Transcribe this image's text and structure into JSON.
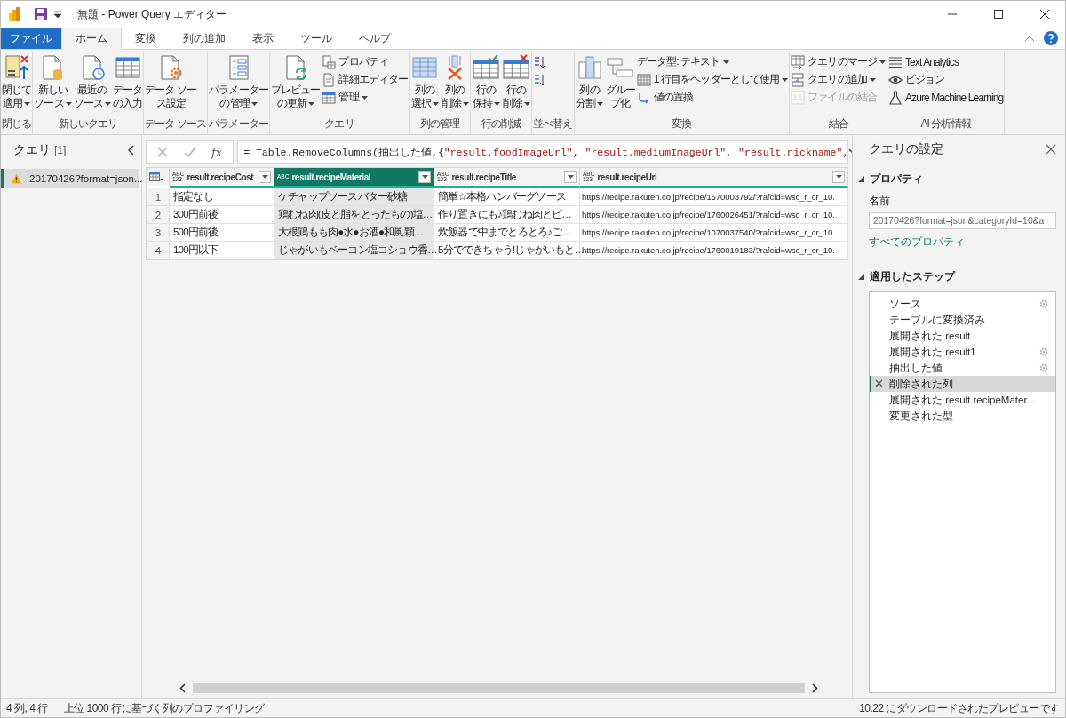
{
  "window": {
    "title": "無題 - Power Query エディター"
  },
  "ribbon_tabs": [
    {
      "label": "ファイル",
      "kind": "file",
      "selected": false
    },
    {
      "label": "ホーム",
      "kind": "tab",
      "selected": true
    },
    {
      "label": "変換",
      "kind": "tab",
      "selected": false
    },
    {
      "label": "列の追加",
      "kind": "tab",
      "selected": false
    },
    {
      "label": "表示",
      "kind": "tab",
      "selected": false
    },
    {
      "label": "ツール",
      "kind": "tab",
      "selected": false
    },
    {
      "label": "ヘルプ",
      "kind": "tab",
      "selected": false
    }
  ],
  "ribbon_groups": [
    {
      "label": "閉じる",
      "items": [
        {
          "kind": "large",
          "label": [
            "閉じて",
            "適用"
          ],
          "dropdown": true,
          "disabled": false
        }
      ]
    },
    {
      "label": "新しいクエリ",
      "items": [
        {
          "kind": "large",
          "label": [
            "新しい",
            "ソース"
          ],
          "dropdown": true,
          "disabled": false
        },
        {
          "kind": "large",
          "label": [
            "最近の",
            "ソース"
          ],
          "dropdown": true,
          "disabled": false
        },
        {
          "kind": "large",
          "label": [
            "データ",
            "の入力"
          ],
          "dropdown": false,
          "disabled": false
        }
      ]
    },
    {
      "label": "データ ソース",
      "items": [
        {
          "kind": "large",
          "label": [
            "データ ソー",
            "ス設定"
          ],
          "dropdown": false,
          "disabled": false
        }
      ]
    },
    {
      "label": "パラメーター",
      "items": [
        {
          "kind": "large",
          "label": [
            "パラメーター",
            "の管理"
          ],
          "dropdown": true,
          "disabled": false
        }
      ]
    },
    {
      "label": "クエリ",
      "items": [
        {
          "kind": "large",
          "label": [
            "プレビュー",
            "の更新"
          ],
          "dropdown": true,
          "disabled": false
        },
        {
          "kind": "small",
          "label": "プロパティ",
          "dropdown": false,
          "disabled": false
        },
        {
          "kind": "small",
          "label": "詳細エディター",
          "dropdown": false,
          "disabled": false
        },
        {
          "kind": "small",
          "label": "管理",
          "dropdown": true,
          "disabled": false
        }
      ]
    },
    {
      "label": "列の管理",
      "items": [
        {
          "kind": "large",
          "label": [
            "列の",
            "選択"
          ],
          "dropdown": true,
          "disabled": false
        },
        {
          "kind": "large",
          "label": [
            "列の",
            "削除"
          ],
          "dropdown": true,
          "disabled": false
        }
      ]
    },
    {
      "label": "行の削減",
      "items": [
        {
          "kind": "large",
          "label": [
            "行の",
            "保持"
          ],
          "dropdown": true,
          "disabled": false
        },
        {
          "kind": "large",
          "label": [
            "行の",
            "削除"
          ],
          "dropdown": true,
          "disabled": false
        }
      ]
    },
    {
      "label": "並べ替え",
      "items": [
        {
          "kind": "icon",
          "dropdown": false,
          "disabled": false
        },
        {
          "kind": "icon",
          "dropdown": false,
          "disabled": false
        }
      ]
    },
    {
      "label": "変換",
      "items": [
        {
          "kind": "large",
          "label": [
            "列の",
            "分割"
          ],
          "dropdown": true,
          "disabled": false
        },
        {
          "kind": "large",
          "label": [
            "グルー",
            "プ化"
          ],
          "dropdown": false,
          "disabled": false
        },
        {
          "kind": "small",
          "label": "データ型: テキスト",
          "dropdown": true,
          "disabled": false
        },
        {
          "kind": "small",
          "label": "1 行目をヘッダーとして使用",
          "dropdown": true,
          "disabled": false
        },
        {
          "kind": "small",
          "label": "値の置換",
          "dropdown": false,
          "disabled": false
        }
      ]
    },
    {
      "label": "結合",
      "items": [
        {
          "kind": "small",
          "label": "クエリのマージ",
          "dropdown": true,
          "disabled": false
        },
        {
          "kind": "small",
          "label": "クエリの追加",
          "dropdown": true,
          "disabled": false
        },
        {
          "kind": "small",
          "label": "ファイルの結合",
          "dropdown": false,
          "disabled": true
        }
      ]
    },
    {
      "label": "AI 分析情報",
      "items": [
        {
          "kind": "small",
          "label": "Text Analytics",
          "dropdown": false,
          "disabled": false
        },
        {
          "kind": "small",
          "label": "ビジョン",
          "dropdown": false,
          "disabled": false
        },
        {
          "kind": "small",
          "label": "Azure Machine Learning",
          "dropdown": false,
          "disabled": false
        }
      ]
    }
  ],
  "queries": {
    "title": "クエリ",
    "count": "[1]",
    "items": [
      {
        "label": "20170426?format=json...",
        "selected": true
      }
    ]
  },
  "formula": {
    "label": "fx",
    "segments": [
      {
        "kind": "code",
        "text": "= Table.RemoveColumns(抽出した値,{"
      },
      {
        "kind": "string",
        "text": "\"result.foodImageUrl\""
      },
      {
        "kind": "code",
        "text": ", "
      },
      {
        "kind": "string",
        "text": "\"result.mediumImageUrl\""
      },
      {
        "kind": "code",
        "text": ", "
      },
      {
        "kind": "string",
        "text": "\"result.nickname\""
      },
      {
        "kind": "code",
        "text": ","
      }
    ]
  },
  "table": {
    "columns": [
      {
        "name": "result.recipeCost",
        "type_label": [
          "ABC",
          "123"
        ],
        "selected": false
      },
      {
        "name": "result.recipeMaterial",
        "type_label": [
          "ABC"
        ],
        "selected": true
      },
      {
        "name": "result.recipeTitle",
        "type_label": [
          "ABC",
          "123"
        ],
        "selected": false
      },
      {
        "name": "result.recipeUrl",
        "type_label": [
          "ABC",
          "123"
        ],
        "selected": false
      }
    ],
    "rows": [
      {
        "number": "1",
        "cells": [
          "指定なし",
          "ケチャップソースバター砂糖",
          "簡単☆本格ハンバーグソース",
          "https://recipe.rakuten.co.jp/recipe/1570003792/?rafcid=wsc_r_cr_10."
        ]
      },
      {
        "number": "2",
        "cells": [
          "300円前後",
          "鶏むね肉(皮と脂をとったもの)塩…",
          "作り置きにも♪鶏むね肉とピ…",
          "https://recipe.rakuten.co.jp/recipe/1760026451/?rafcid=wsc_r_cr_10."
        ]
      },
      {
        "number": "3",
        "cells": [
          "500円前後",
          "大根鶏もも肉●水●お酒●和風顆…",
          "炊飯器で中までとろとろ♪ご…",
          "https://recipe.rakuten.co.jp/recipe/1070037540/?rafcid=wsc_r_cr_10."
        ]
      },
      {
        "number": "4",
        "cells": [
          "100円以下",
          "じゃがいもベーコン塩コショウ香…",
          "5分でできちゃう!じゃがいもと…",
          "https://recipe.rakuten.co.jp/recipe/1760019183/?rafcid=wsc_r_cr_10."
        ]
      }
    ]
  },
  "settings": {
    "title": "クエリの設定",
    "properties": {
      "heading": "プロパティ",
      "expanded": true,
      "name_label": "名前",
      "name_value": "20170426?format=json&categoryId=10&a",
      "link": "すべてのプロパティ"
    },
    "steps": {
      "heading": "適用したステップ",
      "expanded": true,
      "items": [
        {
          "label": "ソース",
          "settings": true,
          "selected": false
        },
        {
          "label": "テーブルに変換済み",
          "settings": false,
          "selected": false
        },
        {
          "label": "展開された result",
          "settings": false,
          "selected": false
        },
        {
          "label": "展開された result1",
          "settings": true,
          "selected": false
        },
        {
          "label": "抽出した値",
          "settings": true,
          "selected": false
        },
        {
          "label": "削除された列",
          "settings": false,
          "selected": true
        },
        {
          "label": "展開された result.recipeMater...",
          "settings": false,
          "selected": false
        },
        {
          "label": "変更された型",
          "settings": false,
          "selected": false
        }
      ]
    }
  },
  "status": {
    "left": [
      "4 列, 4 行",
      "上位 1000 行に基づく列のプロファイリング"
    ],
    "right": "10:22 にダウンロードされたプレビューです"
  }
}
